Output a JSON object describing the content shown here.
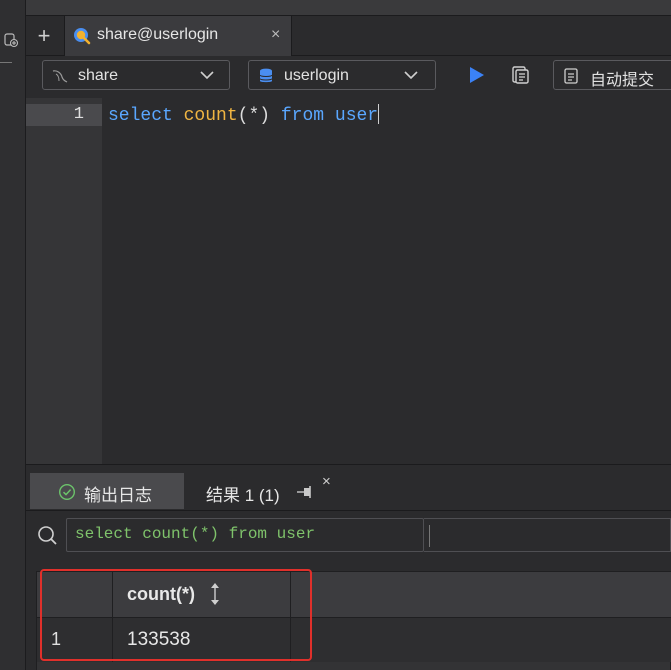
{
  "tab": {
    "label": "share@userlogin",
    "close": "×"
  },
  "new_tab": "+",
  "toolbar": {
    "connection": "share",
    "database": "userlogin",
    "autocommit": "自动提交"
  },
  "editor": {
    "line_number": "1",
    "tokens": {
      "select": "select",
      "count": "count",
      "paren": "(*)",
      "from": "from",
      "table": "user"
    }
  },
  "panel": {
    "log_tab": "输出日志",
    "result_tab": "结果 1 (1)",
    "result_close": "×",
    "filter_text": "select count(*) from user"
  },
  "grid": {
    "columns": [
      "count(*)"
    ],
    "rows": [
      {
        "num": "1",
        "values": [
          "133538"
        ]
      }
    ]
  },
  "colors": {
    "keyword": "#5aa7ff",
    "function": "#f0b542",
    "filter_text": "#7fc36b",
    "highlight": "#e0302b",
    "run": "#3b82f6"
  }
}
